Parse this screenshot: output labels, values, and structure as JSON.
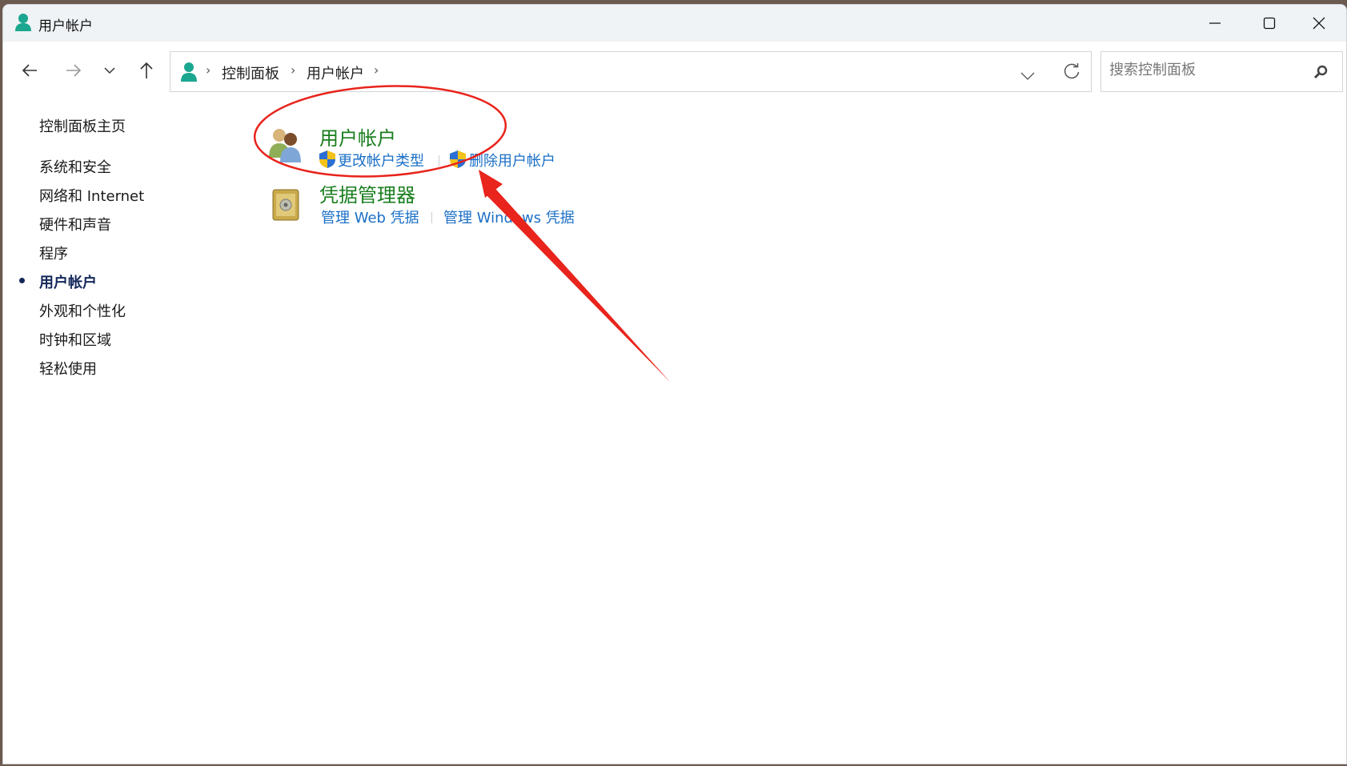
{
  "window": {
    "title": "用户帐户",
    "icon": "user-icon"
  },
  "nav": {
    "back": "back-arrow-icon",
    "forward": "forward-arrow-icon",
    "recent": "chevron-down-icon",
    "up": "up-arrow-icon"
  },
  "address": {
    "crumbs": [
      "控制面板",
      "用户帐户"
    ]
  },
  "search": {
    "placeholder": "搜索控制面板"
  },
  "sidebar": {
    "items": [
      {
        "label": "控制面板主页"
      },
      {
        "label": "系统和安全"
      },
      {
        "label": "网络和 Internet"
      },
      {
        "label": "硬件和声音"
      },
      {
        "label": "程序"
      },
      {
        "label": "用户帐户",
        "current": true
      },
      {
        "label": "外观和个性化"
      },
      {
        "label": "时钟和区域"
      },
      {
        "label": "轻松使用"
      }
    ]
  },
  "categories": [
    {
      "title": "用户帐户",
      "links": [
        "更改帐户类型",
        "删除用户帐户"
      ]
    },
    {
      "title": "凭据管理器",
      "links": [
        "管理 Web 凭据",
        "管理 Windows 凭据"
      ]
    }
  ],
  "annotation": {
    "color": "#e8241c"
  }
}
